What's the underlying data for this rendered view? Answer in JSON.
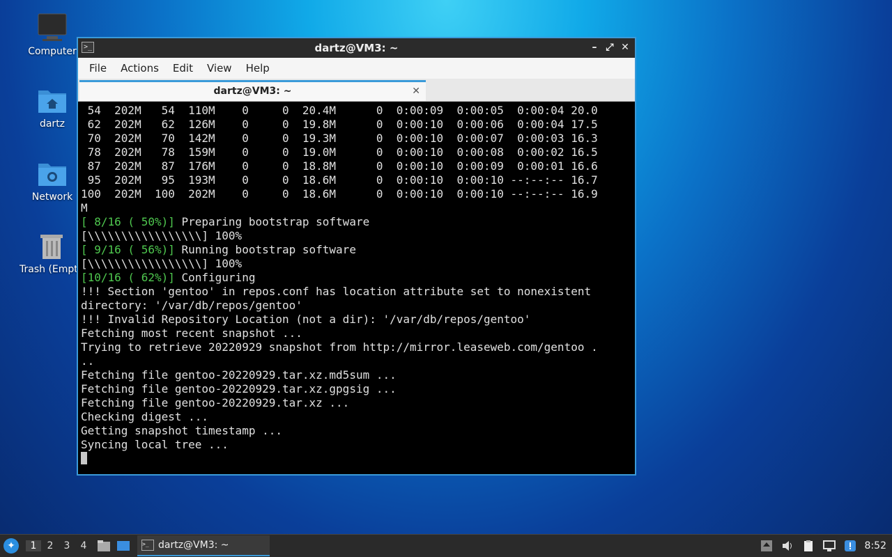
{
  "desktop": {
    "icons": [
      {
        "label": "Computer"
      },
      {
        "label": "dartz"
      },
      {
        "label": "Network"
      },
      {
        "label": "Trash (Empty)"
      }
    ]
  },
  "window": {
    "title": "dartz@VM3: ~",
    "menu": [
      "File",
      "Edit",
      "View",
      "Help",
      "Actions"
    ],
    "menu_items": {
      "file": "File",
      "actions": "Actions",
      "edit": "Edit",
      "view": "View",
      "help": "Help"
    },
    "tab_title": "dartz@VM3: ~"
  },
  "terminal": {
    "lines": [
      " 54  202M   54  110M    0     0  20.4M      0  0:00:09  0:00:05  0:00:04 20.0",
      " 62  202M   62  126M    0     0  19.8M      0  0:00:10  0:00:06  0:00:04 17.5",
      " 70  202M   70  142M    0     0  19.3M      0  0:00:10  0:00:07  0:00:03 16.3",
      " 78  202M   78  159M    0     0  19.0M      0  0:00:10  0:00:08  0:00:02 16.5",
      " 87  202M   87  176M    0     0  18.8M      0  0:00:10  0:00:09  0:00:01 16.6",
      " 95  202M   95  193M    0     0  18.6M      0  0:00:10  0:00:10 --:--:-- 16.7",
      "100  202M  100  202M    0     0  18.6M      0  0:00:10  0:00:10 --:--:-- 16.9",
      "M"
    ],
    "step8_tag": "[ 8/16 ( 50%)]",
    "step8_text": " Preparing bootstrap software",
    "progress1": "[\\\\\\\\\\\\\\\\\\\\\\\\\\\\\\\\\\] 100%",
    "step9_tag": "[ 9/16 ( 56%)]",
    "step9_text": " Running bootstrap software",
    "progress2": "[\\\\\\\\\\\\\\\\\\\\\\\\\\\\\\\\\\] 100%",
    "step10_tag": "[10/16 ( 62%)]",
    "step10_text": " Configuring",
    "tail": [
      "!!! Section 'gentoo' in repos.conf has location attribute set to nonexistent",
      "directory: '/var/db/repos/gentoo'",
      "!!! Invalid Repository Location (not a dir): '/var/db/repos/gentoo'",
      "Fetching most recent snapshot ...",
      "Trying to retrieve 20220929 snapshot from http://mirror.leaseweb.com/gentoo .",
      "..",
      "Fetching file gentoo-20220929.tar.xz.md5sum ...",
      "Fetching file gentoo-20220929.tar.xz.gpgsig ...",
      "Fetching file gentoo-20220929.tar.xz ...",
      "Checking digest ...",
      "Getting snapshot timestamp ...",
      "Syncing local tree ..."
    ]
  },
  "taskbar": {
    "workspaces": [
      "1",
      "2",
      "3",
      "4"
    ],
    "task_label": "dartz@VM3: ~",
    "clock": "8:52"
  },
  "colors": {
    "accent": "#3a9ad9",
    "terminal_green": "#4fc84f"
  }
}
